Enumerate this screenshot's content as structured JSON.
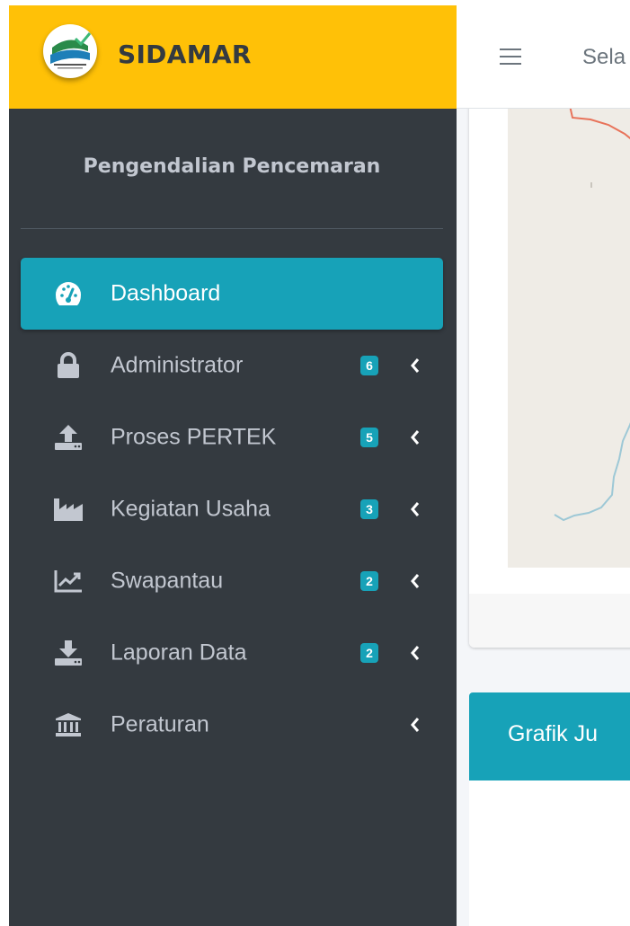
{
  "brand": {
    "name": "SIDAMAR"
  },
  "sidebar": {
    "user_name": "Pengendalian Pencemaran",
    "items": [
      {
        "label": "Dashboard",
        "icon": "tachometer-icon",
        "badge": null,
        "active": true
      },
      {
        "label": "Administrator",
        "icon": "lock-icon",
        "badge": "6",
        "active": false
      },
      {
        "label": "Proses PERTEK",
        "icon": "upload-icon",
        "badge": "5",
        "active": false
      },
      {
        "label": "Kegiatan Usaha",
        "icon": "industry-icon",
        "badge": "3",
        "active": false
      },
      {
        "label": "Swapantau",
        "icon": "chart-line-icon",
        "badge": "2",
        "active": false
      },
      {
        "label": "Laporan Data",
        "icon": "download-icon",
        "badge": "2",
        "active": false
      },
      {
        "label": "Peraturan",
        "icon": "landmark-icon",
        "badge": null,
        "active": false
      }
    ]
  },
  "topbar": {
    "text": "Sela"
  },
  "content": {
    "chart_title": "Grafik Ju"
  },
  "colors": {
    "brand_bg": "#ffc107",
    "sidebar_bg": "#343a40",
    "accent": "#17a2b8",
    "sidebar_text": "#c2c7d0"
  }
}
